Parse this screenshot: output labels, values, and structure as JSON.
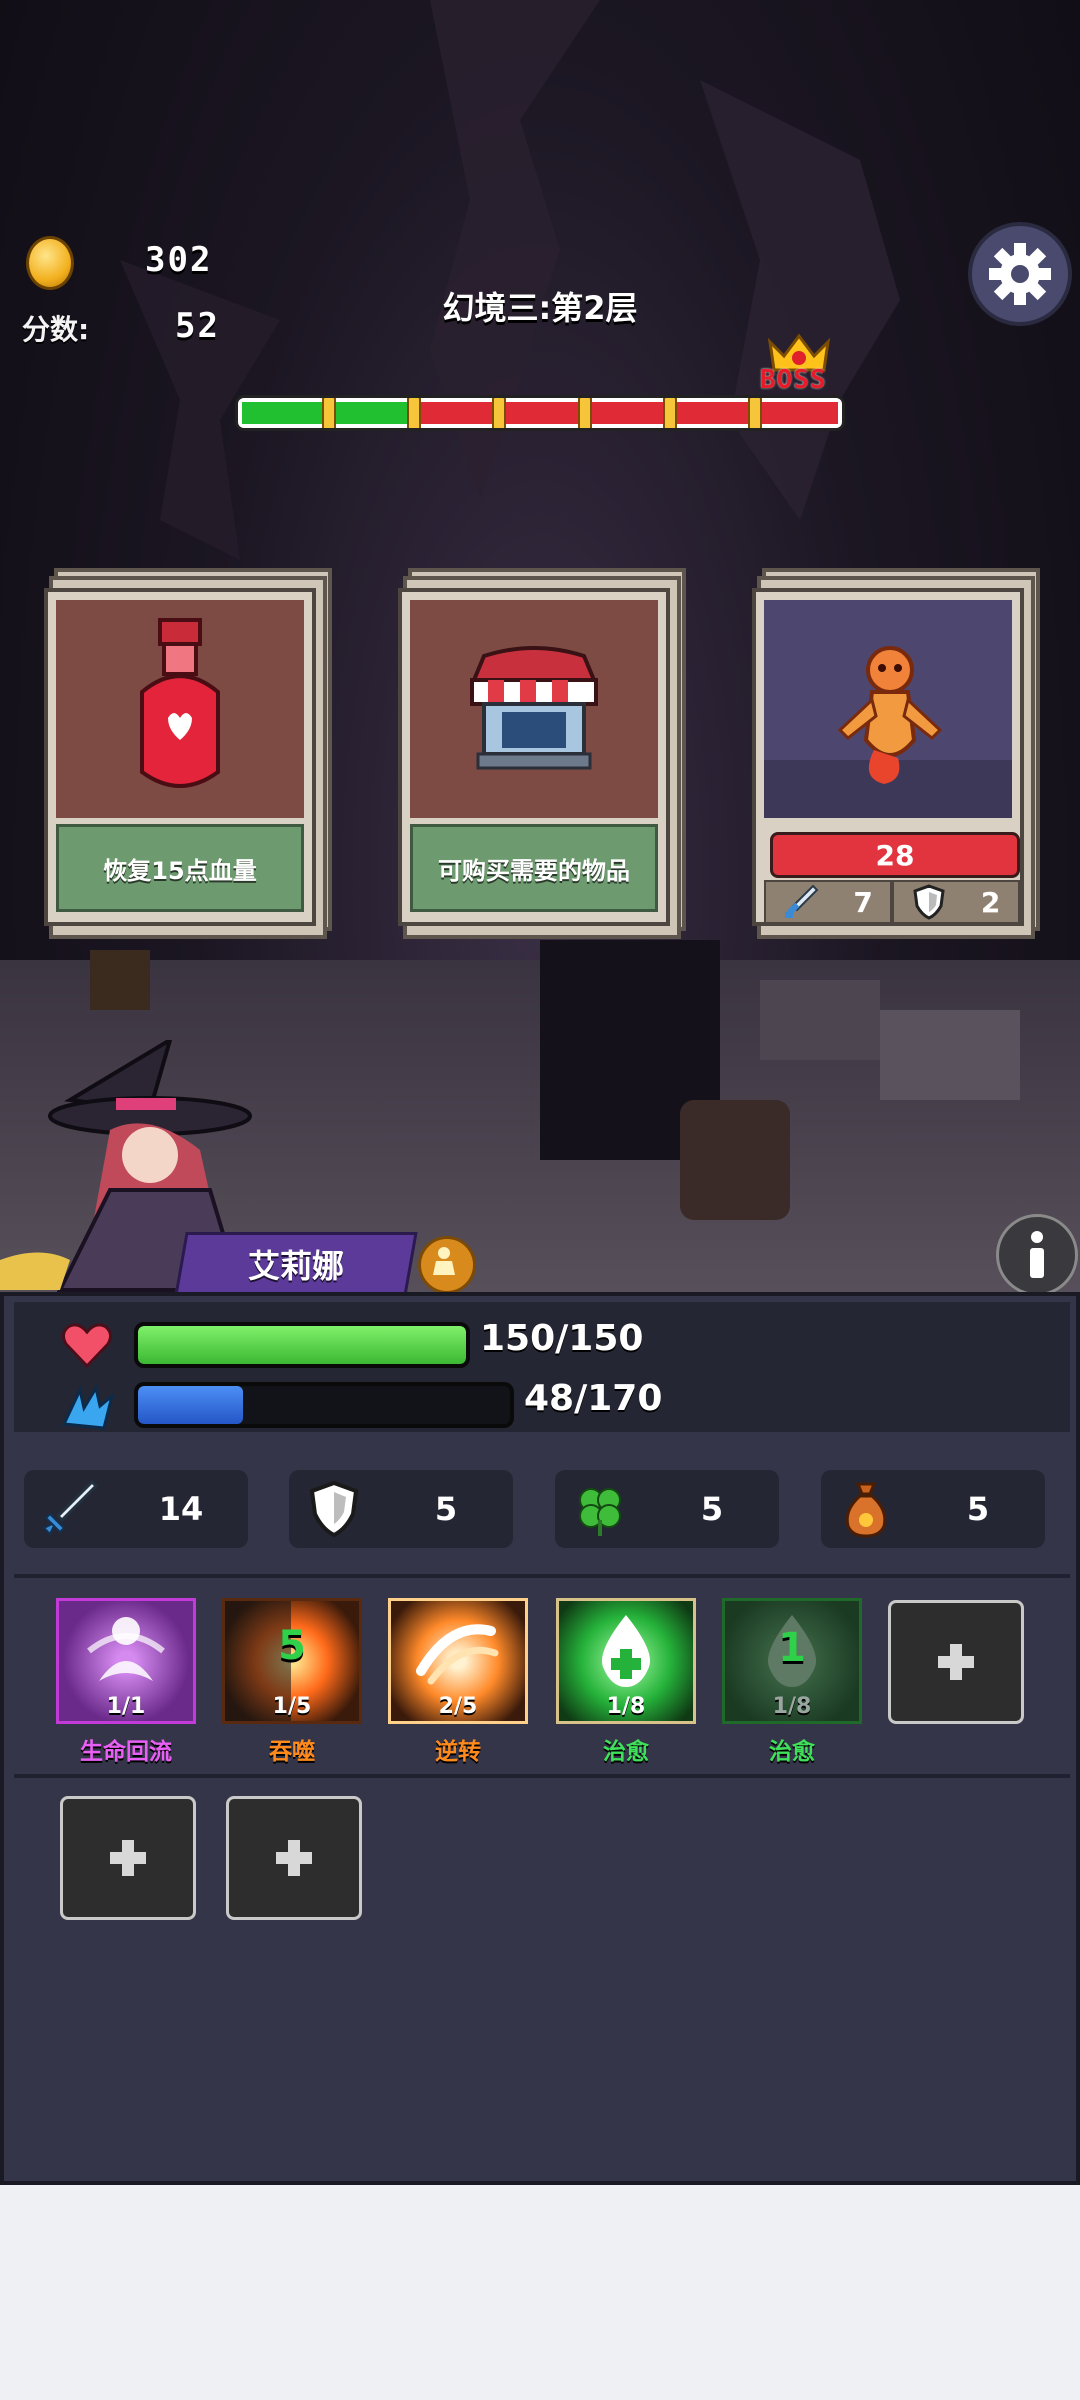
{
  "hud": {
    "coins": "302",
    "score_label": "分数:",
    "score": "52",
    "level_title": "幻境三:第2层",
    "progress": {
      "segments_total": 7,
      "segments_done": 2,
      "boss_label": "BOSS"
    }
  },
  "cards": [
    {
      "type": "potion",
      "description": "恢复15点血量"
    },
    {
      "type": "shop",
      "description": "可购买需要的物品"
    },
    {
      "type": "enemy",
      "hp": "28",
      "attack": "7",
      "defense": "2"
    }
  ],
  "character": {
    "name": "艾莉娜",
    "hp": {
      "current": 150,
      "max": 150,
      "text": "150/150"
    },
    "mp": {
      "current": 48,
      "max": 170,
      "text": "48/170"
    },
    "stats": {
      "attack": "14",
      "defense": "5",
      "luck": "5",
      "gold_bag": "5"
    }
  },
  "skills": [
    {
      "name": "生命回流",
      "count": "1/1",
      "color": "#c23ad8",
      "name_color": "#e95ff5"
    },
    {
      "name": "吞噬",
      "count": "1/5",
      "cooldown": "5",
      "color": "#ff7a1a",
      "name_color": "#ff8a1c"
    },
    {
      "name": "逆转",
      "count": "2/5",
      "color": "#ffb35a",
      "name_color": "#ff8a1c"
    },
    {
      "name": "治愈",
      "count": "1/8",
      "color": "#2fd14a",
      "name_color": "#3fe05a"
    },
    {
      "name": "治愈",
      "count": "1/8",
      "cooldown": "1",
      "color": "#1b7a2e",
      "name_color": "#3fe05a"
    }
  ],
  "colors": {
    "hp_bar": "#58d448",
    "mp_bar": "#2f6fe0",
    "panel": "#343548",
    "progress_done": "#20c030",
    "progress_todo": "#e02a35"
  }
}
